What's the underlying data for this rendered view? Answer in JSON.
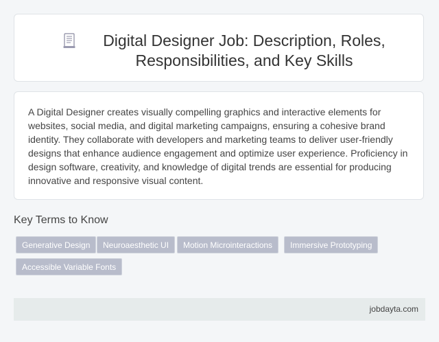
{
  "header": {
    "icon": "document-icon",
    "title": "Digital Designer Job: Description, Roles, Responsibilities, and Key Skills"
  },
  "description": {
    "text": "A Digital Designer creates visually compelling graphics and interactive elements for websites, social media, and digital marketing campaigns, ensuring a cohesive brand identity. They collaborate with developers and marketing teams to deliver user-friendly designs that enhance audience engagement and optimize user experience. Proficiency in design software, creativity, and knowledge of digital trends are essential for producing innovative and responsive visual content."
  },
  "key_terms": {
    "heading": "Key Terms to Know",
    "tags": [
      "Generative Design",
      "Neuroaesthetic UI",
      "Motion Microinteractions",
      "Immersive Prototyping",
      "Accessible Variable Fonts"
    ]
  },
  "footer": {
    "source": "jobdayta.com"
  },
  "colors": {
    "page_background": "#f4f6f8",
    "card_background": "#ffffff",
    "tag_background": "#b8bccb",
    "footer_background": "#e6ebeb"
  }
}
